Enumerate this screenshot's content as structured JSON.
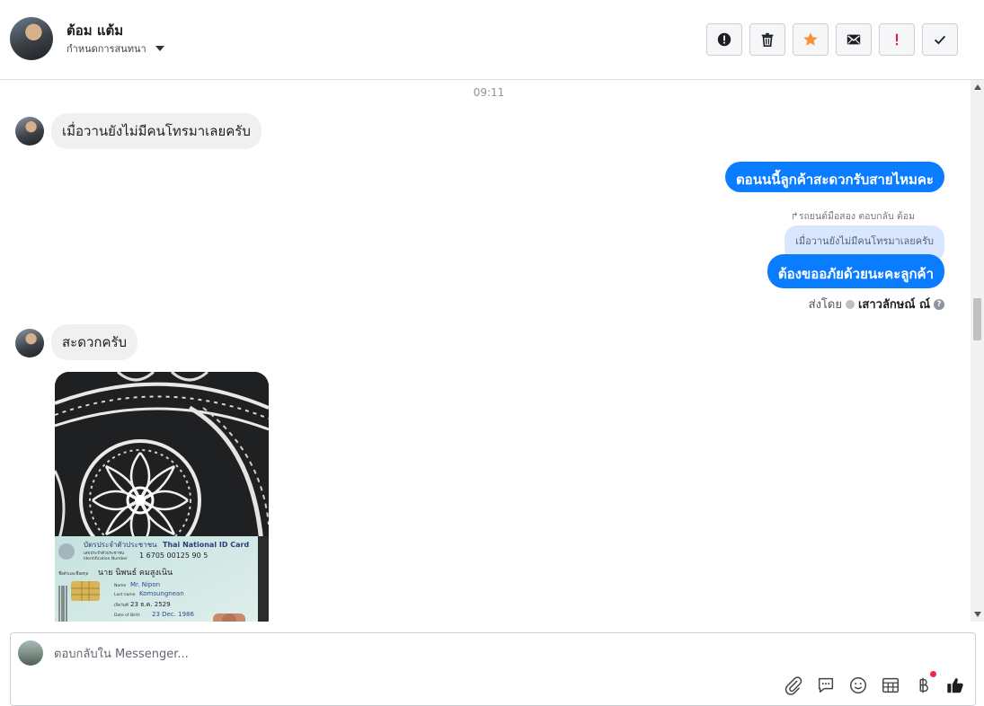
{
  "header": {
    "contact_name": "ต้อม แต้ม",
    "assign_label": "กำหนดการสนทนา",
    "actions": [
      {
        "name": "report-spam-button",
        "icon": "alert-circle-icon"
      },
      {
        "name": "delete-button",
        "icon": "trash-icon"
      },
      {
        "name": "follow-up-button",
        "icon": "star-icon",
        "color": "#f7923b"
      },
      {
        "name": "mark-unread-button",
        "icon": "envelope-icon"
      },
      {
        "name": "mark-important-button",
        "icon": "exclamation-icon",
        "color": "#e41e3f"
      },
      {
        "name": "mark-done-button",
        "icon": "check-icon"
      }
    ]
  },
  "chat": {
    "timestamp": "09:11",
    "messages": [
      {
        "direction": "in",
        "text": "เมื่อวานยังไม่มีคนโทรมาเลยครับ"
      },
      {
        "direction": "out",
        "text": "ตอนนนี้ลูกค้าสะดวกรับสายไหมคะ"
      },
      {
        "direction": "out",
        "reply_note": "รถยนต์มือสอง ตอบกลับ ต้อม",
        "quoted": "เมื่อวานยังไม่มีคนโทรมาเลยครับ",
        "text": "ต้องขออภัยด้วยนะคะลูกค้า"
      },
      {
        "direction": "in",
        "text": "สะดวกครับ"
      },
      {
        "direction": "in",
        "type": "image",
        "id_card": {
          "title_th": "บัตรประจำตัวประชาชน",
          "title_en": "Thai National ID Card",
          "id_label": "เลขประจำตัวประชาชน",
          "id_label_en": "Identification Number",
          "id_number": "1 6705 00125 90 5",
          "name_label": "ชื่อตัวและชื่อสกุล",
          "name_th": "นาย นิพนธ์ คมสูงเนิน",
          "first_label": "Name",
          "first_name": "Mr. Nipon",
          "last_label": "Last name",
          "last_name": "Komsungnean",
          "dob_label": "เกิดวันที่",
          "dob_th": "23 ธ.ค. 2529",
          "dob_en_label": "Date of Birth",
          "dob_en": "23 Dec. 1986"
        }
      }
    ],
    "sent_by_label": "ส่งโดย",
    "sent_by_name": "เสาวลักษณ์ ณ์",
    "accent": "#0a7cff"
  },
  "composer": {
    "placeholder": "ตอบกลับใน Messenger...",
    "tools": [
      "paperclip-icon",
      "saved-reply-icon",
      "emoji-icon",
      "table-icon",
      "baht-payment-icon",
      "like-icon"
    ]
  }
}
